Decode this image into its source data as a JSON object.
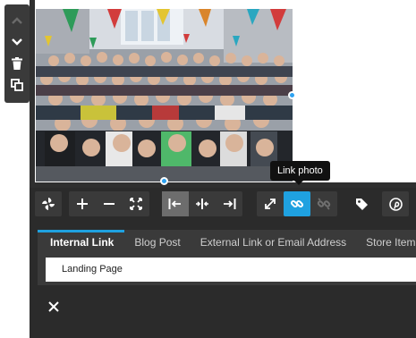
{
  "side_toolbar": {
    "icons": [
      "chevron-up-icon",
      "chevron-down-icon",
      "trash-icon",
      "duplicate-icon"
    ]
  },
  "image": {
    "subject": "group-photo"
  },
  "tooltip": {
    "text": "Link photo"
  },
  "toolbar": {
    "icons": [
      "pinwheel-icon",
      "plus-icon",
      "minus-icon",
      "fit-icon",
      "align-left-icon",
      "align-center-icon",
      "align-right-icon",
      "expand-icon",
      "link-icon",
      "unlink-icon",
      "tag-icon",
      "pinterest-icon"
    ],
    "accent": "#1fa1e0"
  },
  "link_panel": {
    "tabs": [
      {
        "label": "Internal Link"
      },
      {
        "label": "Blog Post"
      },
      {
        "label": "External Link or Email Address"
      },
      {
        "label": "Store Item"
      }
    ],
    "selected_page": "Landing Page",
    "close_icon": "close-icon"
  }
}
